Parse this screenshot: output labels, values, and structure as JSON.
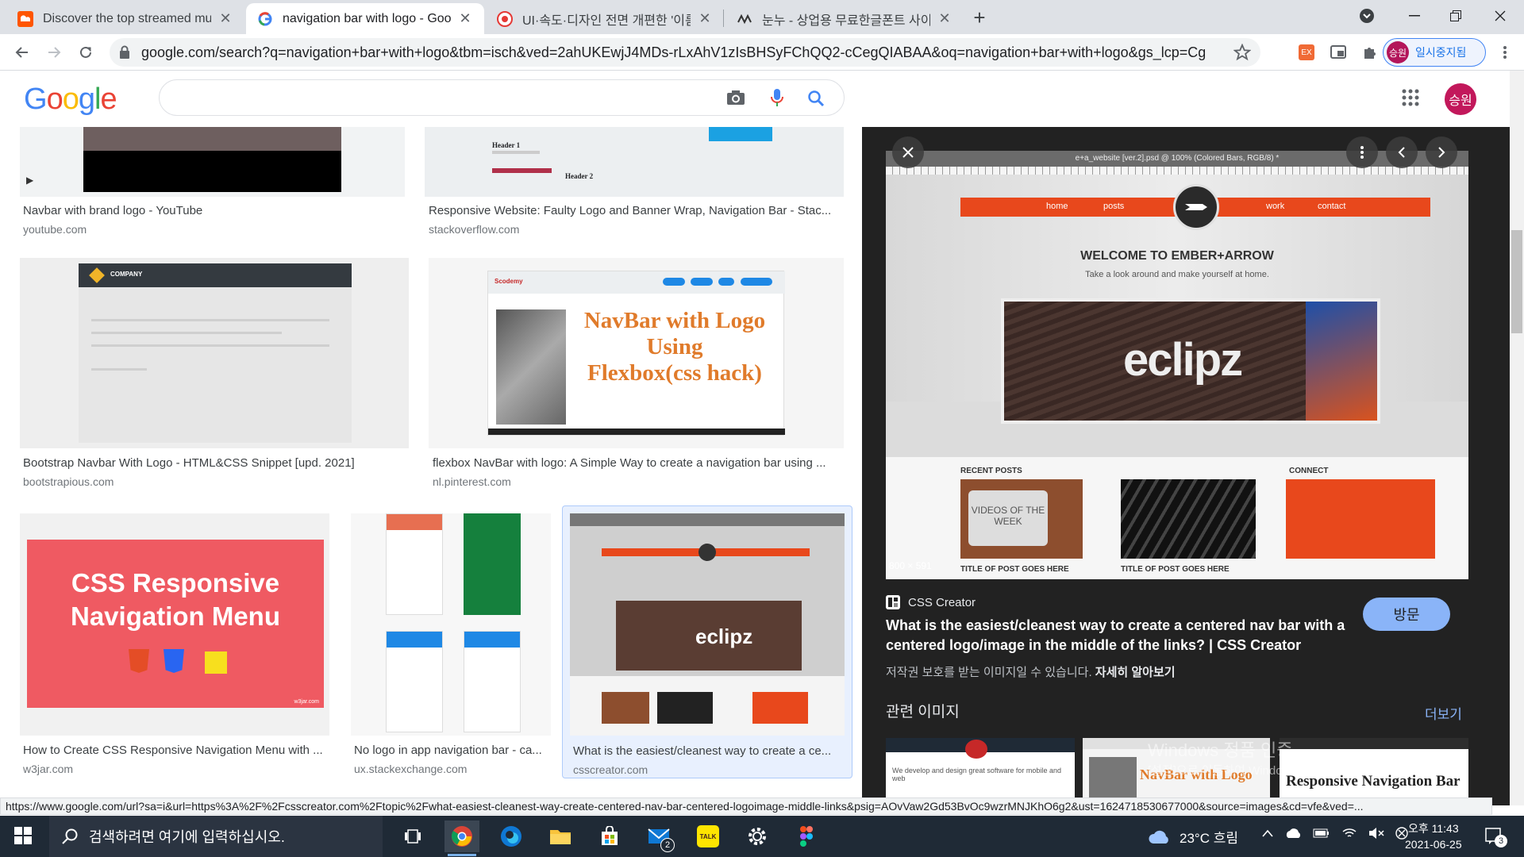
{
  "browser": {
    "tabs": [
      {
        "title": "Discover the top streamed music",
        "favicon": "soundcloud-icon"
      },
      {
        "title": "navigation bar with logo - Google",
        "favicon": "google-icon",
        "active": true
      },
      {
        "title": "UI·속도·디자인 전면 개편한 '이름",
        "favicon": "news-icon"
      },
      {
        "title": "눈누 - 상업용 무료한글폰트 사이",
        "favicon": "noonnu-icon"
      }
    ],
    "url": "google.com/search?q=navigation+bar+with+logo&tbm=isch&ved=2ahUKEwjJ4MDs-rLxAhV1zIsBHSyFChQQ2-cCegQIABAA&oq=navigation+bar+with+logo&gs_lcp=CgNpb...",
    "profile_label": "일시중지됨",
    "profile_initials": "승원",
    "ext_badge": "EX"
  },
  "google": {
    "logo_letters": [
      "G",
      "o",
      "o",
      "g",
      "l",
      "e"
    ],
    "logo_colors": [
      "#4285f4",
      "#ea4335",
      "#fbbc05",
      "#4285f4",
      "#34a853",
      "#ea4335"
    ],
    "search_value": "",
    "avatar": "승원"
  },
  "results": [
    {
      "title": "Navbar with brand logo - YouTube",
      "source": "youtube.com"
    },
    {
      "title": "Responsive Website: Faulty Logo and Banner Wrap, Navigation Bar - Stac...",
      "source": "stackoverflow.com"
    },
    {
      "title": "Bootstrap Navbar With Logo - HTML&CSS Snippet [upd. 2021]",
      "source": "bootstrapious.com"
    },
    {
      "title": "flexbox NavBar with logo: A Simple Way to create a navigation bar using ...",
      "source": "nl.pinterest.com"
    },
    {
      "title": "How to Create CSS Responsive Navigation Menu with ...",
      "source": "w3jar.com"
    },
    {
      "title": "No logo in app navigation bar - ca...",
      "source": "ux.stackexchange.com"
    },
    {
      "title": "What is the easiest/cleanest way to create a ce...",
      "source": "csscreator.com"
    }
  ],
  "thumb_text": {
    "so_header1": "Header 1",
    "so_header2": "Header 2",
    "bootstrap_company": "COMPANY",
    "flexbox_line1": "NavBar with Logo",
    "flexbox_line2": "Using",
    "flexbox_line3": "Flexbox(css hack)",
    "flexbox_brand": "Scodemy",
    "w3_line1": "CSS Responsive",
    "w3_line2": "Navigation Menu",
    "w3_site": "w3jar.com"
  },
  "panel": {
    "image_nav": [
      "home",
      "posts",
      "work",
      "contact"
    ],
    "image_welcome": "WELCOME TO EMBER+ARROW",
    "image_tagline": "Take a look around and make yourself at home.",
    "image_brand": "eclipz",
    "image_recent": "RECENT POSTS",
    "image_connect": "CONNECT",
    "image_post_title": "TITLE OF POST GOES HERE",
    "image_video": "VIDEOS OF THE WEEK",
    "image_ps_title": "e+a_website [ver.2].psd @ 100% (Colored Bars, RGB/8) *",
    "dimensions": "800 × 591",
    "site": "CSS Creator",
    "visit": "방문",
    "title": "What is the easiest/cleanest way to create a centered nav bar with a centered logo/image in the middle of the links? | CSS Creator",
    "copyright": "저작권 보호를 받는 이미지일 수 있습니다.",
    "learn_more": "자세히 알아보기",
    "related_heading": "관련 이미지",
    "more": "더보기",
    "watermark1": "Windows 정품 인증",
    "watermark2": "[설정]으로 이동하여 Windows를 정품 인증합니다.",
    "related_text": [
      "We develop and design great software for mobile and web",
      "NavBar with Logo",
      "Responsive Navigation Bar"
    ]
  },
  "status_url": "https://www.google.com/url?sa=i&url=https%3A%2F%2Fcsscreator.com%2Ftopic%2Fwhat-easiest-cleanest-way-create-centered-nav-bar-centered-logoimage-middle-links&psig=AOvVaw2Gd53BvOc9wzrMNJKhO6g2&ust=1624718530677000&source=images&cd=vfe&ved=...",
  "taskbar": {
    "search_placeholder": "검색하려면 여기에 입력하십시오.",
    "weather": "23°C 흐림",
    "time": "오후 11:43",
    "date": "2021-06-25",
    "mail_badge": "2",
    "notification_count": "3",
    "kakao": "TALK"
  }
}
